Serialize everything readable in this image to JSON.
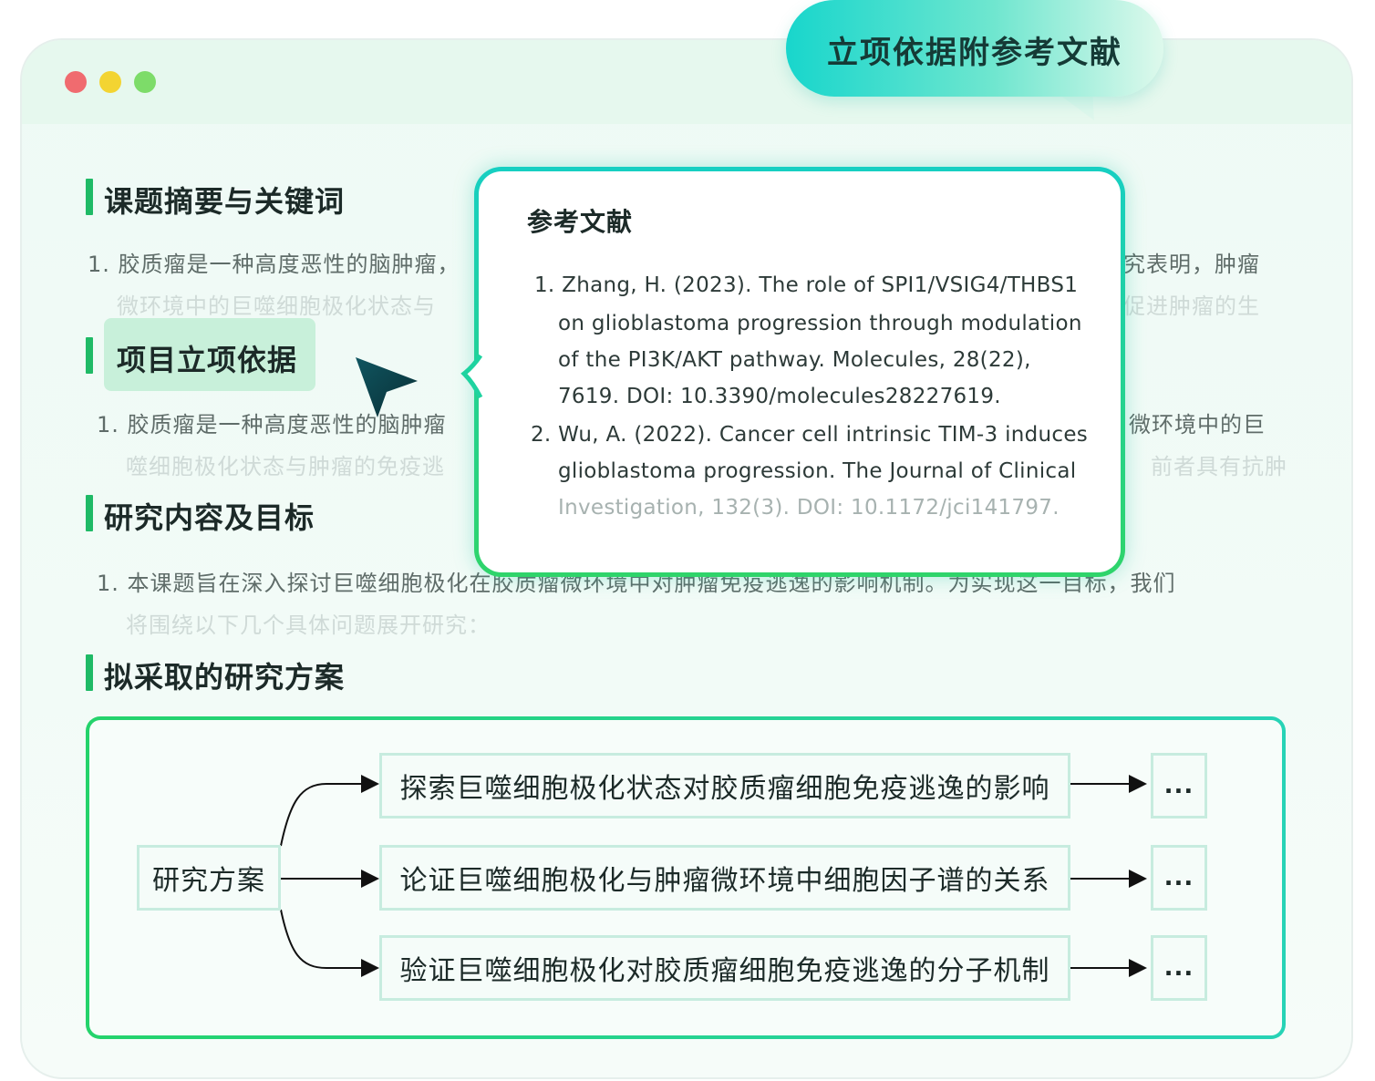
{
  "header": {
    "bubble_text": "立项依据附参考文献"
  },
  "sections": [
    {
      "title": "课题摘要与关键词",
      "line1_left": "1. 胶质瘤是一种高度恶性的脑肿瘤，",
      "line1_right": "究表明，肿瘤",
      "line2_left": "微环境中的巨噬细胞极化状态与",
      "line2_right": "促进肿瘤的生"
    },
    {
      "title": "项目立项依据",
      "line1_left": "1. 胶质瘤是一种高度恶性的脑肿瘤",
      "line1_right": "微环境中的巨",
      "line2_left": "噬细胞极化状态与肿瘤的免疫逃",
      "line2_right": "前者具有抗肿"
    },
    {
      "title": "研究内容及目标",
      "line1": "1. 本课题旨在深入探讨巨噬细胞极化在胶质瘤微环境中对肿瘤免疫逃逸的影响机制。为实现这一目标，我们",
      "line2": "将围绕以下几个具体问题展开研究："
    },
    {
      "title": "拟采取的研究方案"
    }
  ],
  "popup": {
    "title": "参考文献",
    "refs": [
      "1. Zhang, H. (2023). The role of SPI1/VSIG4/THBS1",
      "on glioblastoma progression through modulation",
      "of the PI3K/AKT pathway. Molecules, 28(22),",
      "7619. DOI: 10.3390/molecules28227619.",
      "2. Wu, A. (2022). Cancer cell intrinsic TIM-3 induces",
      "glioblastoma progression. The Journal of Clinical",
      "Investigation, 132(3). DOI: 10.1172/jci141797."
    ]
  },
  "plan": {
    "root": "研究方案",
    "branches": [
      "探索巨噬细胞极化状态对胶质瘤细胞免疫逃逸的影响",
      "论证巨噬细胞极化与肿瘤微环境中细胞因子谱的关系",
      "验证巨噬细胞极化对胶质瘤细胞免疫逃逸的分子机制"
    ],
    "next": [
      "...",
      "...",
      "..."
    ]
  },
  "colors": {
    "accent": "#1fba66",
    "teal": "#17cfc2"
  }
}
